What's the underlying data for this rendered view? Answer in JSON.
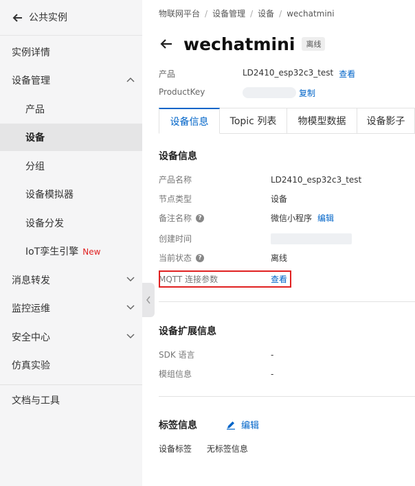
{
  "sidebar": {
    "back_label": "公共实例",
    "items": [
      {
        "label": "实例详情"
      },
      {
        "label": "设备管理"
      },
      {
        "label": "产品"
      },
      {
        "label": "设备"
      },
      {
        "label": "分组"
      },
      {
        "label": "设备模拟器"
      },
      {
        "label": "设备分发"
      },
      {
        "label": "IoT孪生引擎",
        "badge": "New"
      },
      {
        "label": "消息转发"
      },
      {
        "label": "监控运维"
      },
      {
        "label": "安全中心"
      },
      {
        "label": "仿真实验"
      },
      {
        "label": "文档与工具"
      }
    ]
  },
  "breadcrumb": [
    "物联网平台",
    "设备管理",
    "设备",
    "wechatmini"
  ],
  "header": {
    "title": "wechatmini",
    "status": "离线"
  },
  "meta": {
    "product_key_label": "产品",
    "product_value": "LD2410_esp32c3_test",
    "view_link": "查看",
    "productkey_label": "ProductKey",
    "copy_link": "复制"
  },
  "tabs": [
    "设备信息",
    "Topic 列表",
    "物模型数据",
    "设备影子"
  ],
  "device_info": {
    "title": "设备信息",
    "rows": [
      {
        "label": "产品名称",
        "value": "LD2410_esp32c3_test"
      },
      {
        "label": "节点类型",
        "value": "设备"
      },
      {
        "label": "备注名称",
        "value": "微信小程序",
        "link": "编辑"
      },
      {
        "label": "创建时间",
        "value": ""
      },
      {
        "label": "当前状态",
        "value": "离线"
      },
      {
        "label": "MQTT 连接参数",
        "link": "查看"
      }
    ]
  },
  "ext_info": {
    "title": "设备扩展信息",
    "rows": [
      {
        "label": "SDK 语言",
        "value": "-"
      },
      {
        "label": "模组信息",
        "value": "-"
      }
    ]
  },
  "tag_info": {
    "title": "标签信息",
    "edit": "编辑",
    "label": "设备标签",
    "value": "无标签信息"
  },
  "colors": {
    "accent": "#0064c8",
    "highlight": "#e02020",
    "sidebar_bg": "#f5f5f6"
  }
}
